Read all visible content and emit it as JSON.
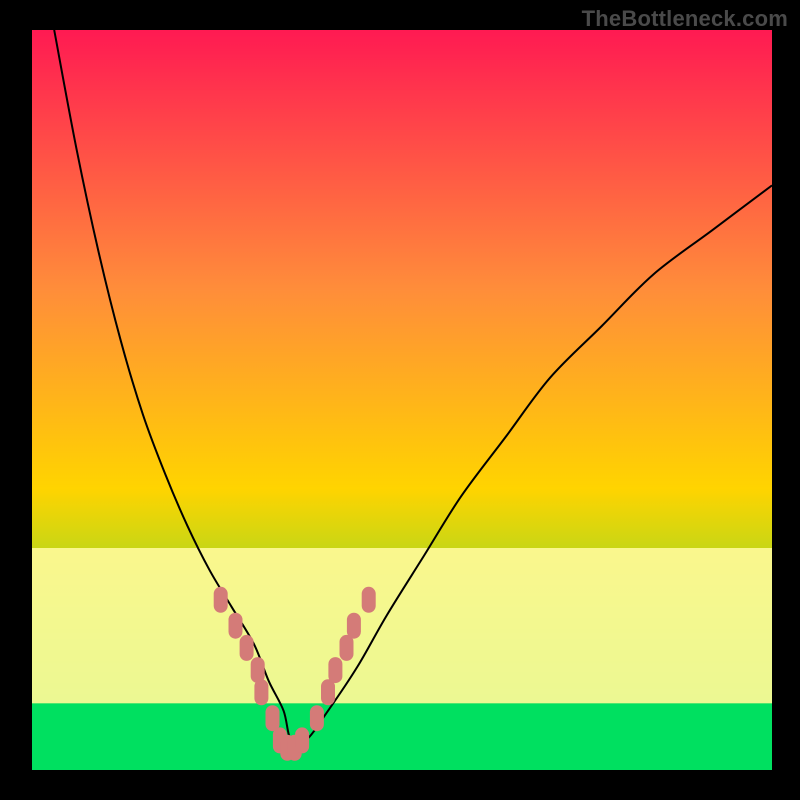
{
  "watermark": "TheBottleneck.com",
  "chart_data": {
    "type": "line",
    "title": "",
    "xlabel": "",
    "ylabel": "",
    "xlim": [
      0,
      100
    ],
    "ylim": [
      0,
      100
    ],
    "background_gradient": {
      "top": "#ff1a52",
      "mid": "#ffd400",
      "bottom": "#00e060"
    },
    "green_band_top_y": 91,
    "series": [
      {
        "name": "curve",
        "color": "#000000",
        "x": [
          3,
          6,
          9,
          12,
          15,
          18,
          21,
          24,
          27,
          30,
          32,
          34,
          35,
          37,
          40,
          44,
          48,
          53,
          58,
          64,
          70,
          77,
          84,
          92,
          100
        ],
        "y": [
          100,
          84,
          70,
          58,
          48,
          40,
          33,
          27,
          22,
          17,
          12,
          8,
          4,
          4,
          8,
          14,
          21,
          29,
          37,
          45,
          53,
          60,
          67,
          73,
          79
        ]
      },
      {
        "name": "dot-markers",
        "color": "#d47b78",
        "style": "pill",
        "x": [
          25.5,
          27.5,
          29.0,
          30.5,
          31.0,
          32.5,
          33.5,
          34.5,
          35.5,
          36.5,
          38.5,
          40.0,
          41.0,
          42.5,
          43.5,
          45.5
        ],
        "y": [
          23.0,
          19.5,
          16.5,
          13.5,
          10.5,
          7.0,
          4.0,
          3.0,
          3.0,
          4.0,
          7.0,
          10.5,
          13.5,
          16.5,
          19.5,
          23.0
        ]
      }
    ],
    "pale_yellow_band": {
      "from_y": 70,
      "to_y": 91,
      "color": "#fffb9a"
    }
  }
}
